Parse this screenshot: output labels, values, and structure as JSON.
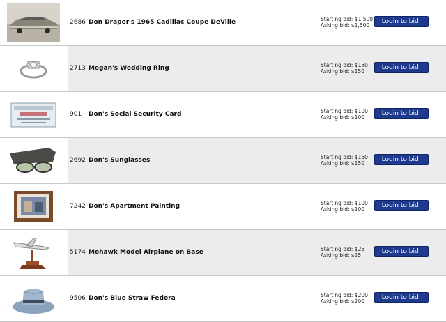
{
  "items": [
    {
      "lot": "2686",
      "title": "Don Draper's 1965 Cadillac Coupe DeVille",
      "starting": "Starting bid: $1,500",
      "asking": "Asking bid: $1,500",
      "button": "Login to bid!",
      "image": "car-thumbnail"
    },
    {
      "lot": "2713",
      "title": "Megan's Wedding Ring",
      "starting": "Starting bid: $150",
      "asking": "Asking bid: $150",
      "button": "Login to bid!",
      "image": "ring-thumbnail"
    },
    {
      "lot": "901",
      "title": "Don's Social Security Card",
      "starting": "Starting bid: $100",
      "asking": "Asking bid: $100",
      "button": "Login to bid!",
      "image": "card-thumbnail"
    },
    {
      "lot": "2692",
      "title": "Don's Sunglasses",
      "starting": "Starting bid: $150",
      "asking": "Asking bid: $150",
      "button": "Login to bid!",
      "image": "sunglasses-thumbnail"
    },
    {
      "lot": "7242",
      "title": "Don's Apartment Painting",
      "starting": "Starting bid: $100",
      "asking": "Asking bid: $100",
      "button": "Login to bid!",
      "image": "painting-thumbnail"
    },
    {
      "lot": "5174",
      "title": "Mohawk Model Airplane on Base",
      "starting": "Starting bid: $25",
      "asking": "Asking bid: $25",
      "button": "Login to bid!",
      "image": "airplane-thumbnail"
    },
    {
      "lot": "9506",
      "title": "Don's Blue Straw Fedora",
      "starting": "Starting bid: $200",
      "asking": "Asking bid: $200",
      "button": "Login to bid!",
      "image": "fedora-thumbnail"
    }
  ]
}
